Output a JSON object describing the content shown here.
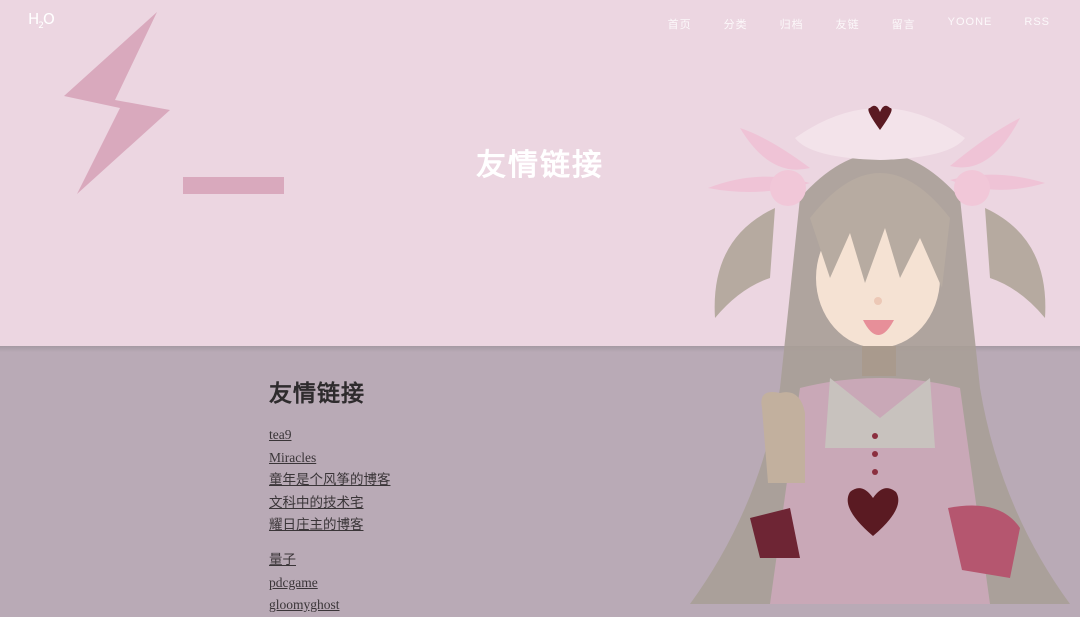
{
  "header": {
    "logo_text": "H",
    "logo_sub": "2",
    "logo_tail": "O",
    "nav": [
      "首页",
      "分类",
      "归档",
      "友链",
      "留言",
      "YOONE",
      "RSS"
    ]
  },
  "hero": {
    "title": "友情链接"
  },
  "main": {
    "heading": "友情链接",
    "links_group1": [
      "tea9",
      "Miracles",
      "童年是个风筝的博客",
      "文科中的技术宅",
      "耀日庄主的博客"
    ],
    "links_group2": [
      "量子",
      "pdcgame",
      "gloomyghost"
    ]
  },
  "colors": {
    "hero_bg": "#ecd6e1",
    "body_bg": "#b9aab6",
    "accent": "#d9a9bd",
    "heart": "#5a1a22"
  }
}
